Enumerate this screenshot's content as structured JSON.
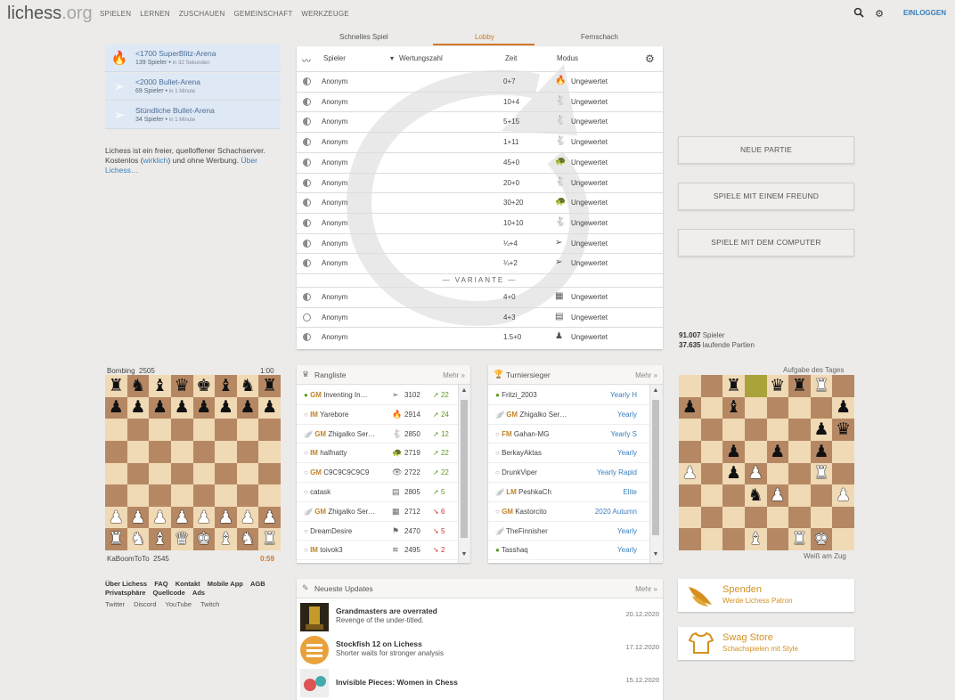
{
  "header": {
    "logo_main": "lichess",
    "logo_tld": ".org",
    "nav": [
      "SPIELEN",
      "LERNEN",
      "ZUSCHAUEN",
      "GEMEINSCHAFT",
      "WERKZEUGE"
    ],
    "login": "EINLOGGEN",
    "icons": [
      "search-icon",
      "gear-icon"
    ]
  },
  "tournaments": [
    {
      "name": "<1700 SuperBlitz-Arena",
      "players": "139 Spieler",
      "when": "in 32 Sekunden",
      "icon": "flame-icon"
    },
    {
      "name": "<2000 Bullet-Arena",
      "players": "69 Spieler",
      "when": "in 1 Minute",
      "icon": "bullet-icon"
    },
    {
      "name": "Stündliche Bullet-Arena",
      "players": "34 Spieler",
      "when": "in 1 Minute",
      "icon": "bullet-icon"
    }
  ],
  "about": {
    "text1": "Lichess ist ein freier, quelloffener Schachserver. Kostenlos (",
    "link1": "wirklich",
    "text2": ") und ohne Werbung. ",
    "link2": "Über Lichess…"
  },
  "tabs": [
    "Schnelles Spiel",
    "Lobby",
    "Fernschach"
  ],
  "lobby": {
    "headers": {
      "player": "Spieler",
      "rating": "Wertungszahl",
      "time": "Zeit",
      "mode": "Modus"
    },
    "rows": [
      {
        "player": "Anonym",
        "time": "0+7",
        "mode": "Ungewertet",
        "icon": "🔥"
      },
      {
        "player": "Anonym",
        "time": "10+4",
        "mode": "Ungewertet",
        "icon": "🐇"
      },
      {
        "player": "Anonym",
        "time": "5+15",
        "mode": "Ungewertet",
        "icon": "🐇"
      },
      {
        "player": "Anonym",
        "time": "1+11",
        "mode": "Ungewertet",
        "icon": "🐇"
      },
      {
        "player": "Anonym",
        "time": "45+0",
        "mode": "Ungewertet",
        "icon": "🐢"
      },
      {
        "player": "Anonym",
        "time": "20+0",
        "mode": "Ungewertet",
        "icon": "🐇"
      },
      {
        "player": "Anonym",
        "time": "30+20",
        "mode": "Ungewertet",
        "icon": "🐢"
      },
      {
        "player": "Anonym",
        "time": "10+10",
        "mode": "Ungewertet",
        "icon": "🐇"
      },
      {
        "player": "Anonym",
        "time": "¼+4",
        "mode": "Ungewertet",
        "icon": "➢"
      },
      {
        "player": "Anonym",
        "time": "¼+2",
        "mode": "Ungewertet",
        "icon": "➢"
      }
    ],
    "variant_label": "— VARIANTE —",
    "variant_rows": [
      {
        "player": "Anonym",
        "time": "4+0",
        "mode": "Ungewertet",
        "icon": "▦"
      },
      {
        "player": "Anonym",
        "time": "4+3",
        "mode": "Ungewertet",
        "icon": "▤"
      },
      {
        "player": "Anonym",
        "time": "1.5+0",
        "mode": "Ungewertet",
        "icon": "♟"
      }
    ]
  },
  "buttons": [
    "NEUE PARTIE",
    "SPIELE MIT EINEM FREUND",
    "SPIELE MIT DEM COMPUTER"
  ],
  "counts": {
    "players": "91.007",
    "players_label": " Spieler",
    "games": "37.635",
    "games_label": " laufende Partien"
  },
  "tv": {
    "top_player": "Bombing",
    "top_rating": "2505",
    "top_clock": "1:00",
    "bottom_player": "KaBoomToTo",
    "bottom_rating": "2545",
    "bottom_clock": "0:59",
    "position": [
      "rnbqkbnr",
      "pppppppp",
      "........",
      "........",
      "........",
      "........",
      "PPPPPPPP",
      "RNBQKBNR"
    ]
  },
  "leaderboard": {
    "title": "Rangliste",
    "more": "Mehr »",
    "rows": [
      {
        "title": "GM",
        "name": "Inventing In…",
        "icon": "➢",
        "rating": "3102",
        "diff": "22",
        "dir": "up",
        "online": true
      },
      {
        "title": "IM",
        "name": "Yarebore",
        "icon": "🔥",
        "rating": "2914",
        "diff": "24",
        "dir": "up",
        "online": false
      },
      {
        "title": "GM",
        "name": "Zhigalko Ser…",
        "icon": "🐇",
        "rating": "2850",
        "diff": "12",
        "dir": "up",
        "online": false,
        "patron": true
      },
      {
        "title": "IM",
        "name": "halfnatty",
        "icon": "🐢",
        "rating": "2719",
        "diff": "22",
        "dir": "up",
        "online": false
      },
      {
        "title": "GM",
        "name": "C9C9C9C9C9",
        "icon": "👁",
        "rating": "2722",
        "diff": "22",
        "dir": "up",
        "online": false
      },
      {
        "title": "",
        "name": "catask",
        "icon": "▤",
        "rating": "2805",
        "diff": "5",
        "dir": "up",
        "online": false
      },
      {
        "title": "GM",
        "name": "Zhigalko Ser…",
        "icon": "▦",
        "rating": "2712",
        "diff": "6",
        "dir": "down",
        "online": false,
        "patron": true
      },
      {
        "title": "",
        "name": "DreamDesire",
        "icon": "⚑",
        "rating": "2470",
        "diff": "5",
        "dir": "down",
        "online": false
      },
      {
        "title": "IM",
        "name": "toivok3",
        "icon": "≋",
        "rating": "2495",
        "diff": "2",
        "dir": "down",
        "online": false
      }
    ]
  },
  "winners": {
    "title": "Turniersieger",
    "more": "Mehr »",
    "rows": [
      {
        "title": "",
        "name": "Fritzi_2003",
        "event": "Yearly H",
        "online": true
      },
      {
        "title": "GM",
        "name": "Zhigalko Ser…",
        "event": "Yearly",
        "patron": true
      },
      {
        "title": "FM",
        "name": "Gahan-MG",
        "event": "Yearly S"
      },
      {
        "title": "",
        "name": "BerkayAktas",
        "event": "Yearly"
      },
      {
        "title": "",
        "name": "DrunkViper",
        "event": "Yearly Rapid"
      },
      {
        "title": "LM",
        "name": "PeshkaCh",
        "event": "Elite",
        "patron": true
      },
      {
        "title": "GM",
        "name": "Kastorcito",
        "event": "2020 Autumn"
      },
      {
        "title": "",
        "name": "TheFinnisher",
        "event": "Yearly",
        "patron": true
      },
      {
        "title": "",
        "name": "Tasshaq",
        "event": "Yearly",
        "online": true
      }
    ]
  },
  "puzzle": {
    "title": "Aufgabe des Tages",
    "caption": "Weiß am Zug",
    "position": [
      "..r.qrR.",
      "p.b....p",
      "......pq",
      "..p.p.p.",
      "P.pP..R.",
      "...nP..P",
      "........",
      "...B.RK."
    ]
  },
  "footer": {
    "links1": [
      "Über Lichess",
      "FAQ",
      "Kontakt",
      "Mobile App",
      "AGB",
      "Privatsphäre",
      "Quellcode",
      "Ads"
    ],
    "links2": [
      "Twitter",
      "Discord",
      "YouTube",
      "Twitch"
    ]
  },
  "news": {
    "title": "Neueste Updates",
    "more": "Mehr »",
    "rows": [
      {
        "title": "Grandmasters are overrated",
        "sub": "Revenge of the under-titled.",
        "date": "20.12.2020"
      },
      {
        "title": "Stockfish 12 on Lichess",
        "sub": "Shorter waits for stronger analysis",
        "date": "17.12.2020"
      },
      {
        "title": "Invisible Pieces: Women in Chess",
        "sub": "",
        "date": "15.12.2020"
      }
    ]
  },
  "promos": [
    {
      "title": "Spenden",
      "sub": "Werde Lichess Patron",
      "icon": "wings-icon"
    },
    {
      "title": "Swag Store",
      "sub": "Schachspielen mit Style",
      "icon": "shirt-icon"
    }
  ],
  "colors": {
    "accent": "#d0762a",
    "link": "#3a7fbe",
    "board_light": "#f0d9b5",
    "board_dark": "#b58863",
    "gain": "#629924",
    "loss": "#cc3333"
  }
}
